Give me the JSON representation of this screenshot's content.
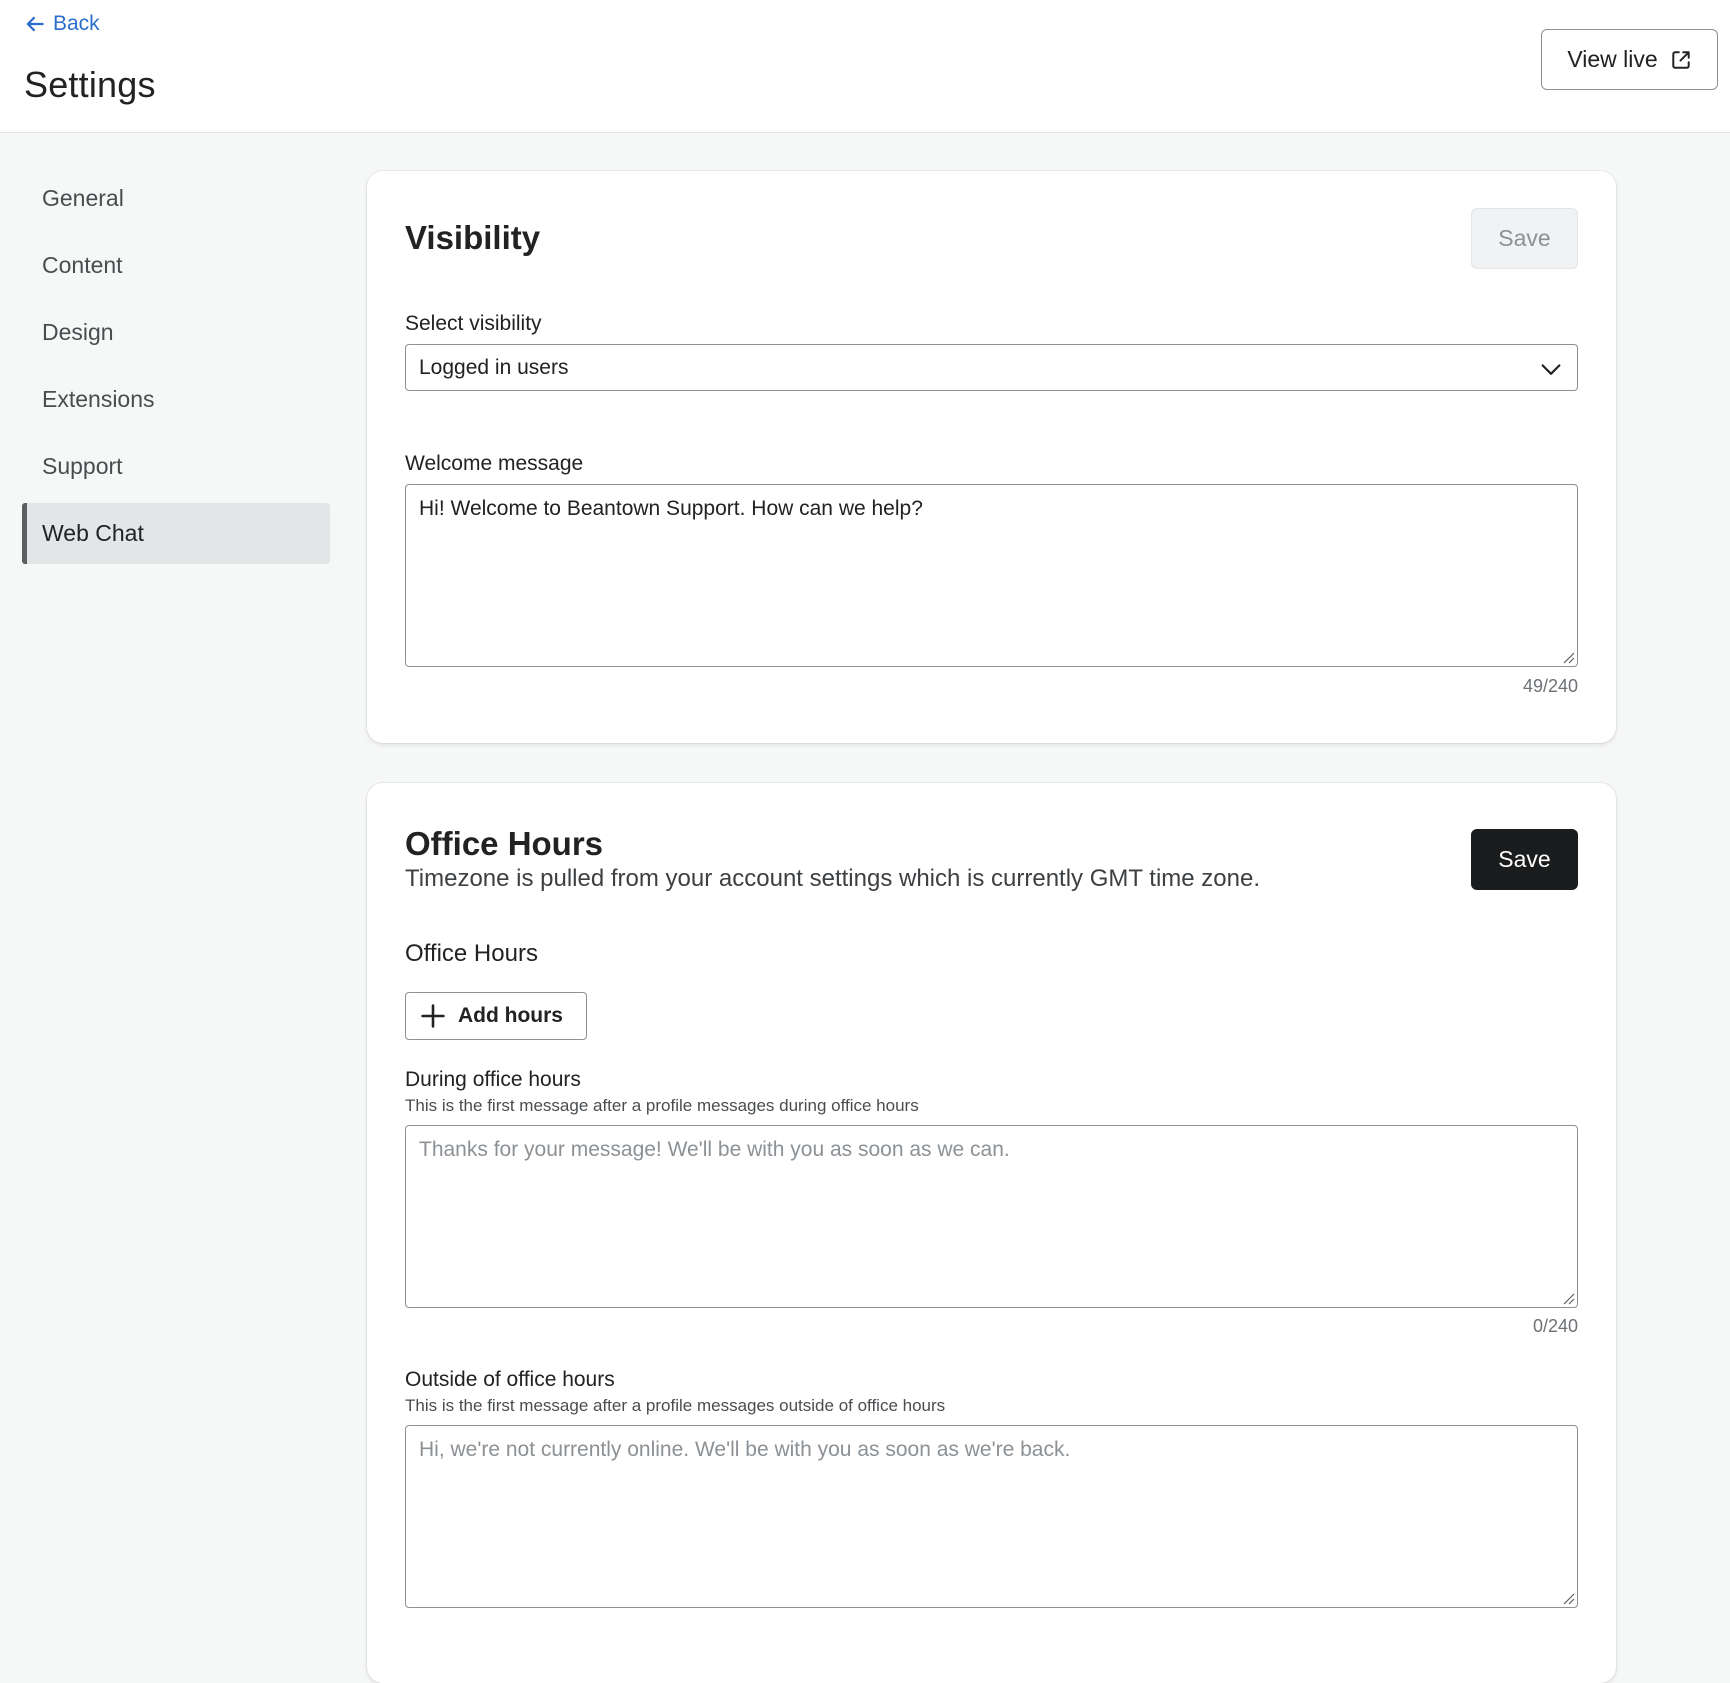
{
  "header": {
    "back_label": "Back",
    "title": "Settings",
    "view_live_label": "View live"
  },
  "sidebar": {
    "items": [
      {
        "label": "General",
        "active": false
      },
      {
        "label": "Content",
        "active": false
      },
      {
        "label": "Design",
        "active": false
      },
      {
        "label": "Extensions",
        "active": false
      },
      {
        "label": "Support",
        "active": false
      },
      {
        "label": "Web Chat",
        "active": true
      }
    ]
  },
  "visibility": {
    "title": "Visibility",
    "save_label": "Save",
    "select_label": "Select visibility",
    "select_value": "Logged in users",
    "welcome_label": "Welcome message",
    "welcome_value": "Hi! Welcome to Beantown Support. How can we help?",
    "welcome_counter": "49/240"
  },
  "office_hours": {
    "title": "Office Hours",
    "subtitle": "Timezone is pulled from your account settings which is currently GMT time zone.",
    "save_label": "Save",
    "section_label": "Office Hours",
    "add_hours_label": "Add hours",
    "during_label": "During office hours",
    "during_help": "This is the first message after a profile messages during office hours",
    "during_placeholder": "Thanks for your message! We'll be with you as soon as we can.",
    "during_counter": "0/240",
    "outside_label": "Outside of office hours",
    "outside_help": "This is the first message after a profile messages outside of office hours",
    "outside_placeholder": "Hi, we're not currently online. We'll be with you as soon as we're back."
  },
  "colors": {
    "link": "#2c6ecb",
    "primary_button": "#1a1c1d",
    "disabled_button": "#f1f2f3",
    "page_background": "#f6f7f7"
  },
  "icons": {
    "back": "arrow-left-icon",
    "external": "external-link-icon",
    "select": "chevron-down-icon",
    "add": "plus-icon"
  }
}
